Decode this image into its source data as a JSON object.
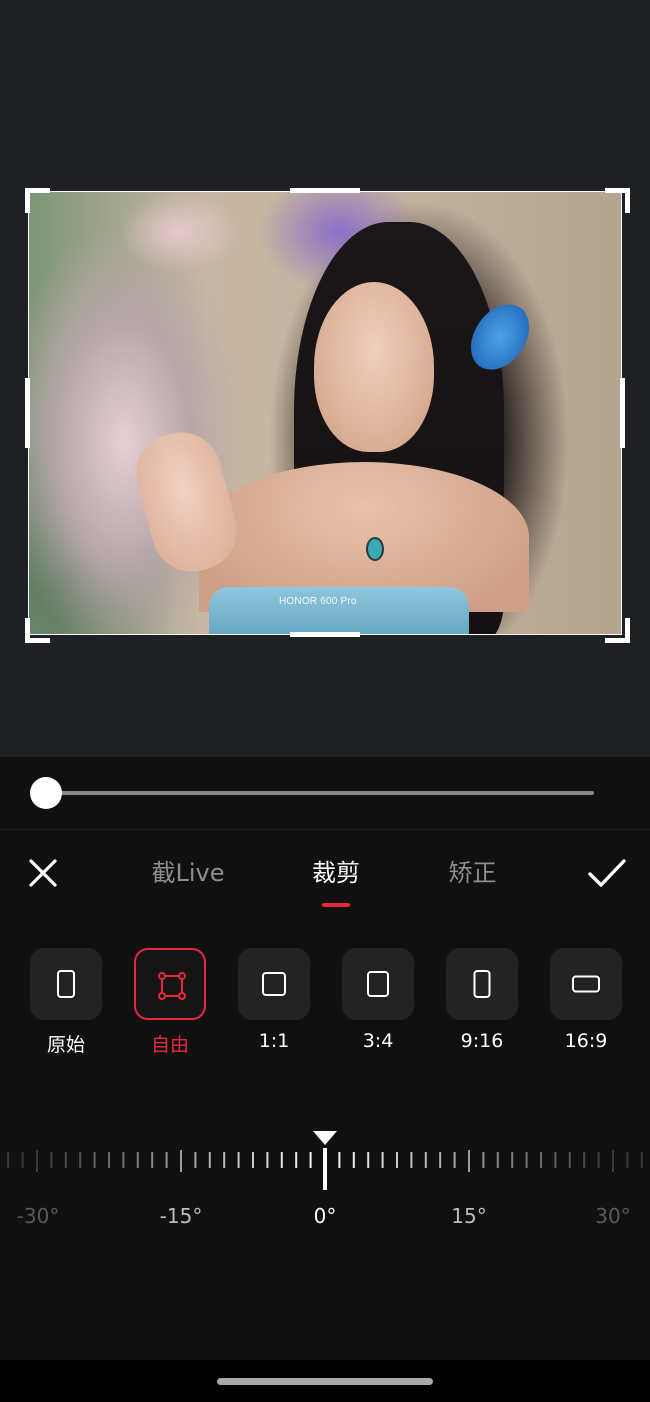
{
  "image": {
    "watermark": "HONOR 600 Pro"
  },
  "editor": {
    "slider_value": 0,
    "tabs": [
      {
        "label": "截Live",
        "active": false
      },
      {
        "label": "裁剪",
        "active": true
      },
      {
        "label": "矫正",
        "active": false
      }
    ],
    "close_icon": "close-icon",
    "confirm_icon": "check-icon",
    "accent_color": "#e8283f"
  },
  "ratios": [
    {
      "label": "原始",
      "icon": "phone-portrait-icon",
      "selected": false
    },
    {
      "label": "自由",
      "icon": "free-crop-icon",
      "selected": true
    },
    {
      "label": "1:1",
      "icon": "square-icon",
      "selected": false
    },
    {
      "label": "3:4",
      "icon": "rect-3-4-icon",
      "selected": false
    },
    {
      "label": "9:16",
      "icon": "rect-9-16-icon",
      "selected": false
    },
    {
      "label": "16:9",
      "icon": "rect-16-9-icon",
      "selected": false
    }
  ],
  "rotation": {
    "current": "0°",
    "labels": [
      "-30°",
      "-15°",
      "0°",
      "15°",
      "30°"
    ]
  }
}
